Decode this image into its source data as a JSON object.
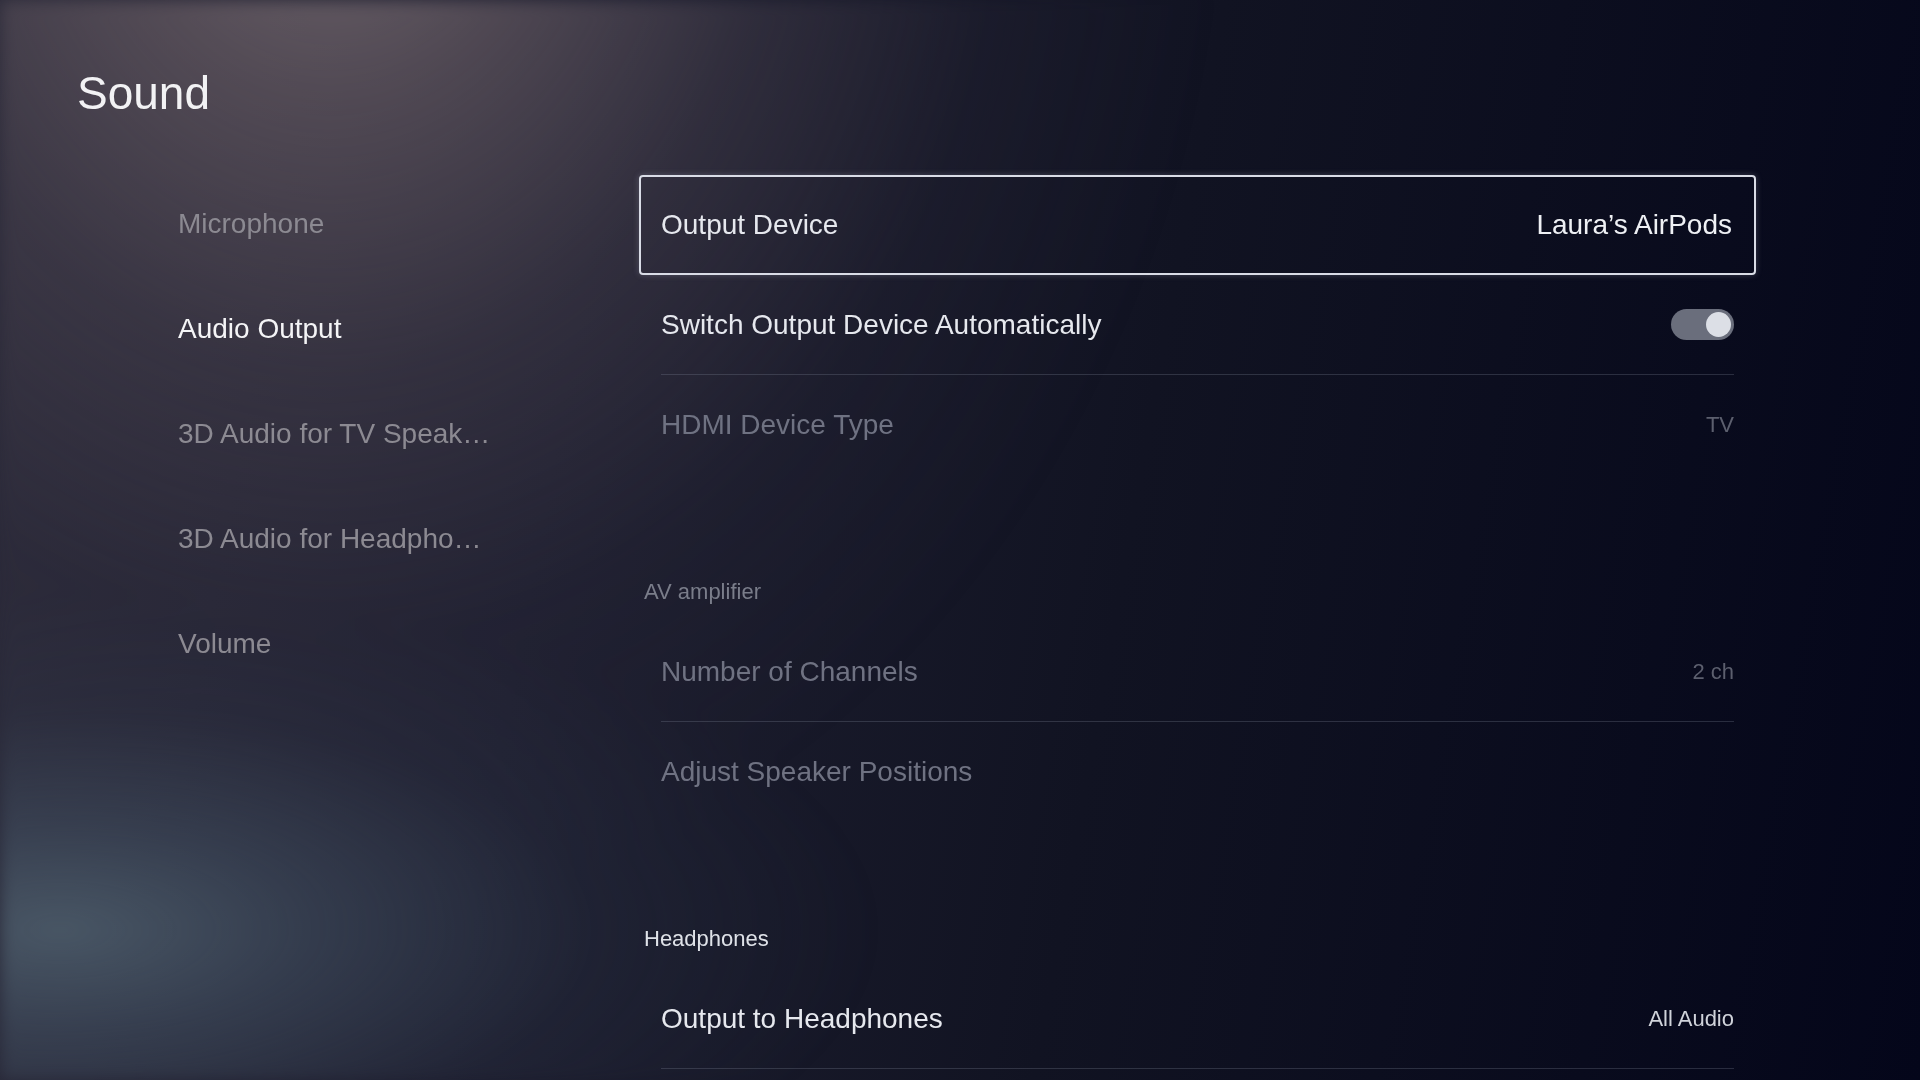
{
  "screen": {
    "title": "Sound"
  },
  "sidebar": {
    "items": [
      {
        "label": "Microphone",
        "selected": false
      },
      {
        "label": "Audio Output",
        "selected": true
      },
      {
        "label": "3D Audio for TV Speak…",
        "selected": false
      },
      {
        "label": "3D Audio for Headpho…",
        "selected": false
      },
      {
        "label": "Volume",
        "selected": false
      }
    ]
  },
  "settings": {
    "sections": [
      {
        "rows": [
          {
            "kind": "value",
            "label": "Output Device",
            "value": "Laura’s AirPods",
            "selected": true,
            "disabled": false
          },
          {
            "kind": "toggle",
            "label": "Switch Output Device Automatically",
            "on": true,
            "selected": false,
            "disabled": false
          },
          {
            "kind": "value",
            "label": "HDMI Device Type",
            "value": "TV",
            "selected": false,
            "disabled": true
          }
        ]
      },
      {
        "heading": "AV amplifier",
        "disabled": true,
        "rows": [
          {
            "kind": "value",
            "label": "Number of Channels",
            "value": "2 ch",
            "selected": false,
            "disabled": true
          },
          {
            "kind": "action",
            "label": "Adjust Speaker Positions",
            "selected": false,
            "disabled": true
          }
        ]
      },
      {
        "heading": "Headphones",
        "disabled": false,
        "rows": [
          {
            "kind": "value",
            "label": "Output to Headphones",
            "value": "All Audio",
            "selected": false,
            "disabled": false
          }
        ]
      }
    ]
  }
}
